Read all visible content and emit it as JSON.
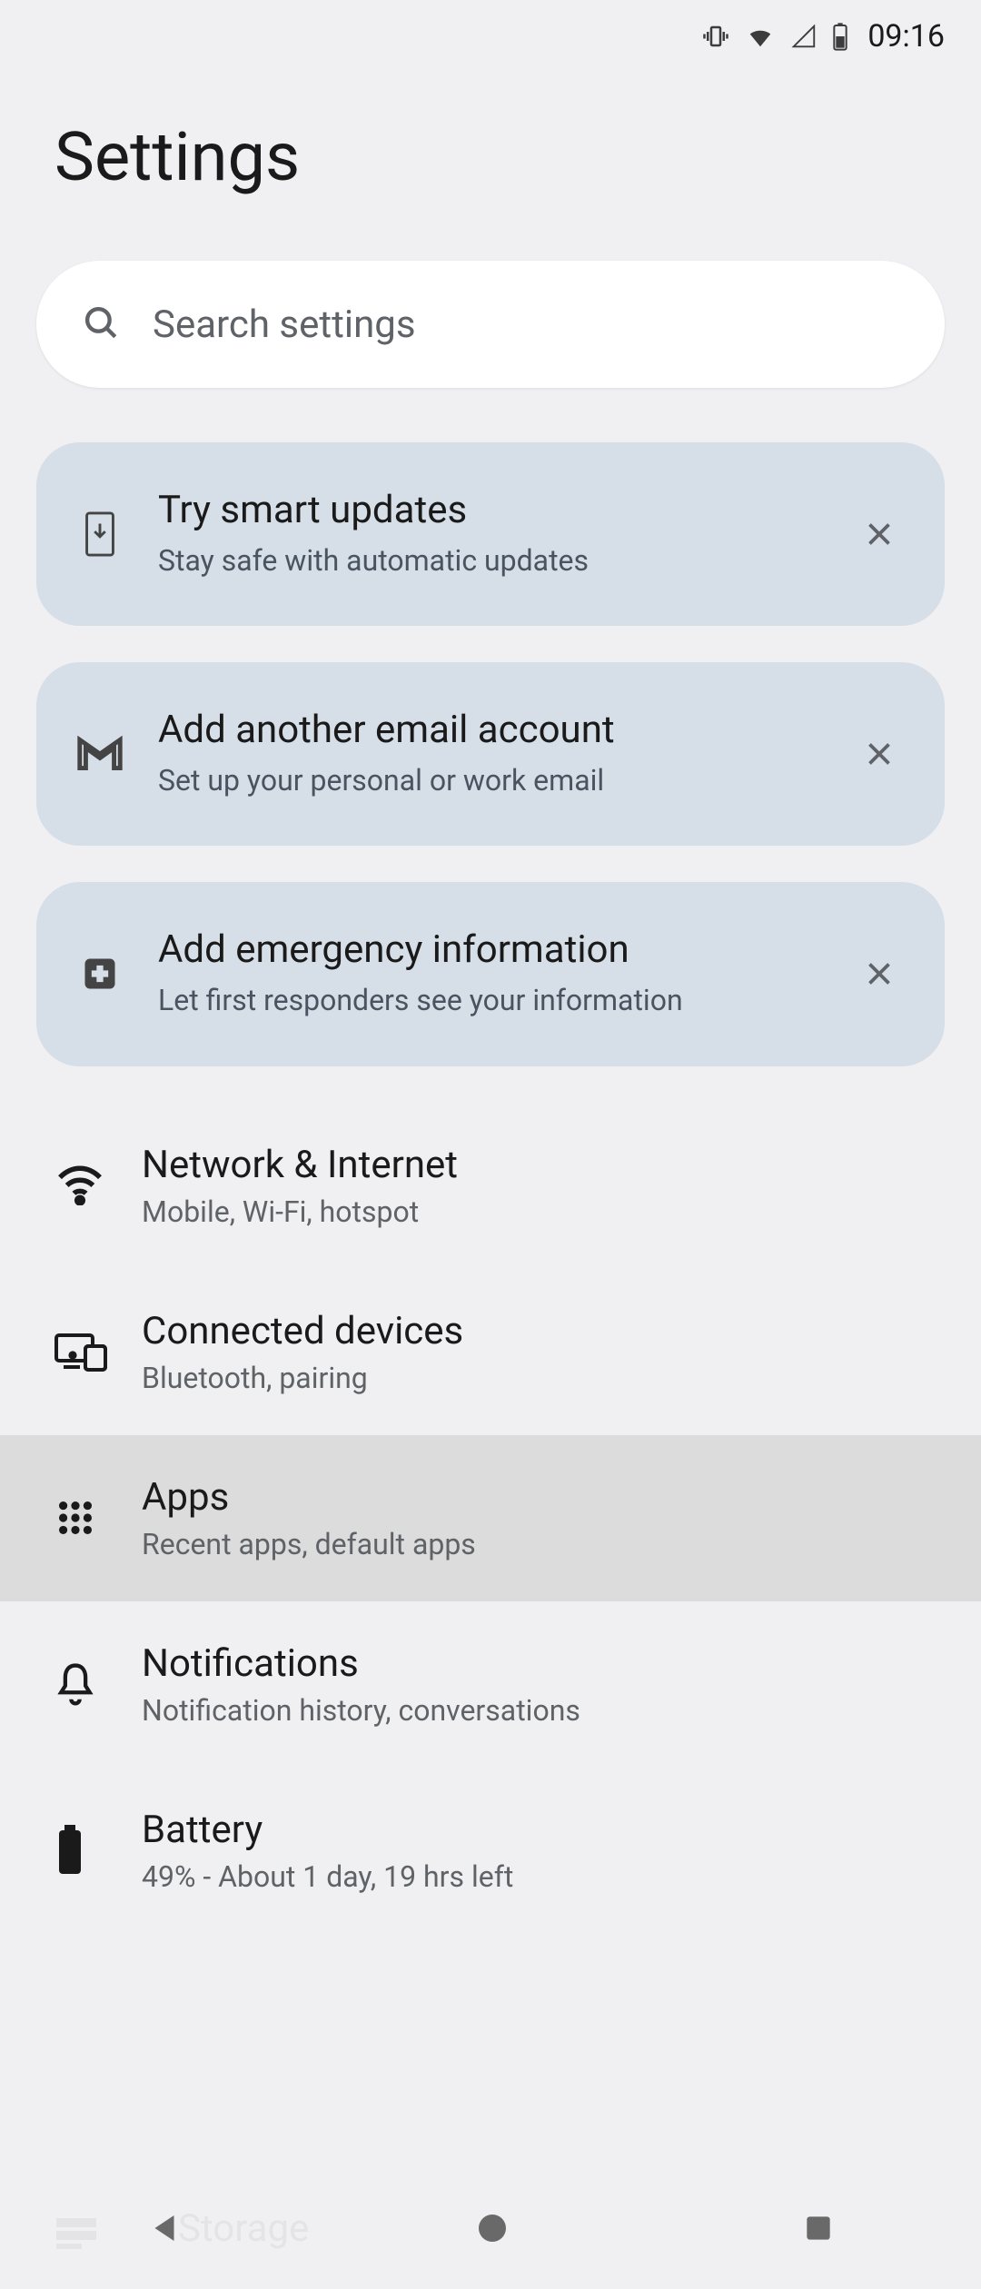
{
  "status_bar": {
    "time": "09:16"
  },
  "page": {
    "title": "Settings"
  },
  "search": {
    "placeholder": "Search settings"
  },
  "suggestions": [
    {
      "icon": "update-phone-icon",
      "title": "Try smart updates",
      "subtitle": "Stay safe with automatic updates"
    },
    {
      "icon": "gmail-icon",
      "title": "Add another email account",
      "subtitle": "Set up your personal or work email"
    },
    {
      "icon": "medical-icon",
      "title": "Add emergency information",
      "subtitle": "Let first responders see your information"
    }
  ],
  "items": [
    {
      "icon": "wifi-icon",
      "title": "Network & Internet",
      "subtitle": "Mobile, Wi-Fi, hotspot",
      "highlighted": false
    },
    {
      "icon": "devices-icon",
      "title": "Connected devices",
      "subtitle": "Bluetooth, pairing",
      "highlighted": false
    },
    {
      "icon": "apps-icon",
      "title": "Apps",
      "subtitle": "Recent apps, default apps",
      "highlighted": true
    },
    {
      "icon": "bell-icon",
      "title": "Notifications",
      "subtitle": "Notification history, conversations",
      "highlighted": false
    },
    {
      "icon": "battery-icon",
      "title": "Battery",
      "subtitle": "49% - About 1 day, 19 hrs left",
      "highlighted": false
    }
  ],
  "partial_item": {
    "icon": "storage-icon",
    "title": "Storage"
  }
}
